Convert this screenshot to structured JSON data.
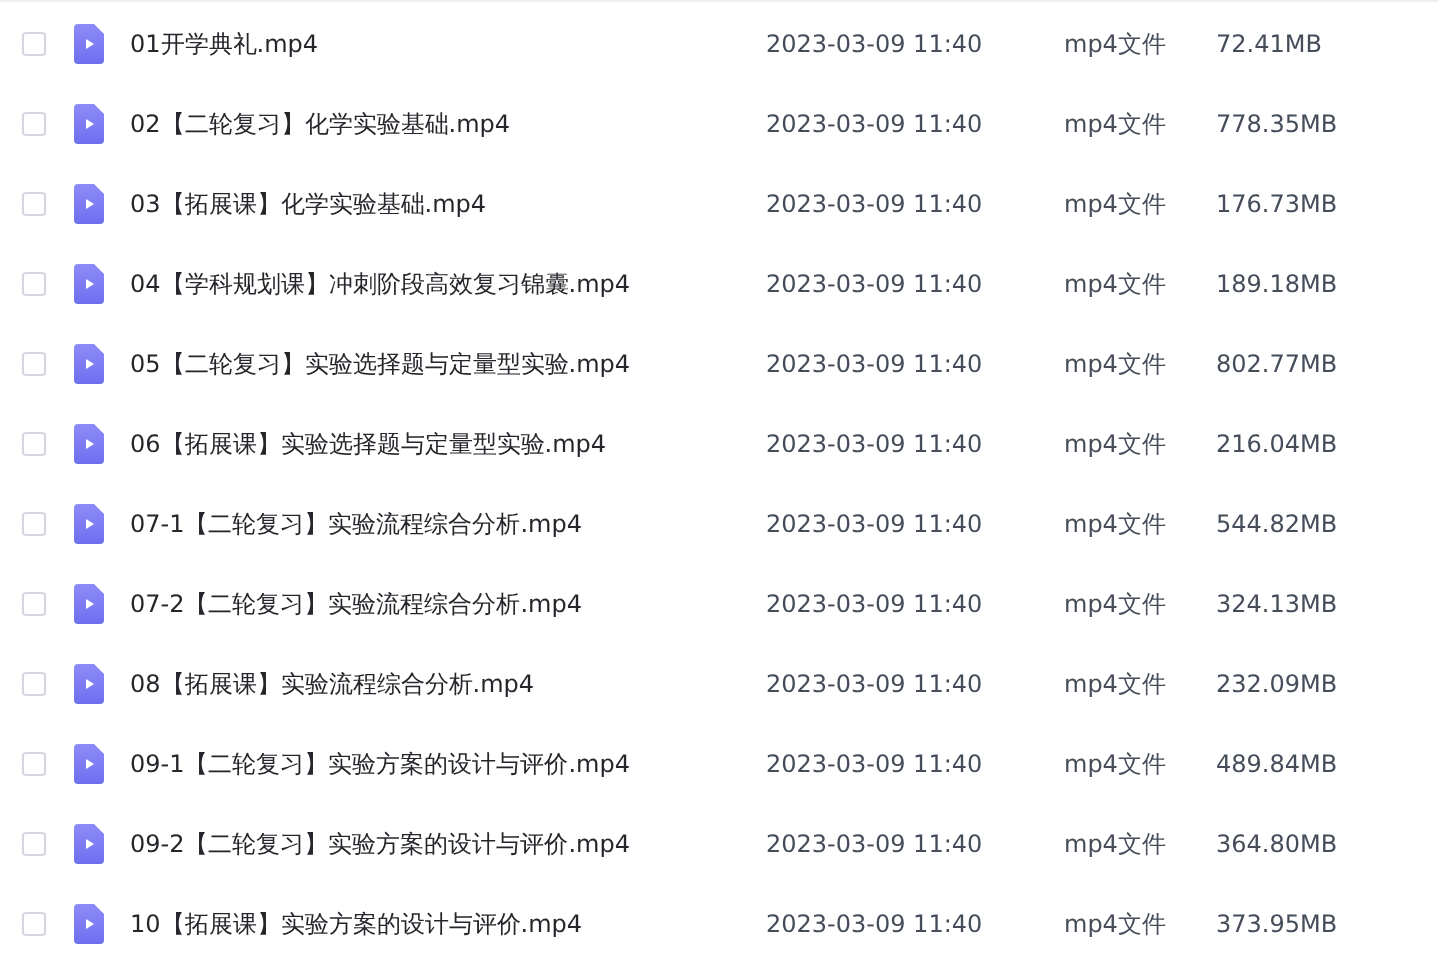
{
  "files": [
    {
      "name": "01开学典礼.mp4",
      "modified": "2023-03-09 11:40",
      "type": "mp4文件",
      "size": "72.41MB",
      "checked": false
    },
    {
      "name": "02【二轮复习】化学实验基础.mp4",
      "modified": "2023-03-09 11:40",
      "type": "mp4文件",
      "size": "778.35MB",
      "checked": false
    },
    {
      "name": "03【拓展课】化学实验基础.mp4",
      "modified": "2023-03-09 11:40",
      "type": "mp4文件",
      "size": "176.73MB",
      "checked": false
    },
    {
      "name": "04【学科规划课】冲刺阶段高效复习锦囊.mp4",
      "modified": "2023-03-09 11:40",
      "type": "mp4文件",
      "size": "189.18MB",
      "checked": false
    },
    {
      "name": "05【二轮复习】实验选择题与定量型实验.mp4",
      "modified": "2023-03-09 11:40",
      "type": "mp4文件",
      "size": "802.77MB",
      "checked": false
    },
    {
      "name": "06【拓展课】实验选择题与定量型实验.mp4",
      "modified": "2023-03-09 11:40",
      "type": "mp4文件",
      "size": "216.04MB",
      "checked": false
    },
    {
      "name": "07-1【二轮复习】实验流程综合分析.mp4",
      "modified": "2023-03-09 11:40",
      "type": "mp4文件",
      "size": "544.82MB",
      "checked": false
    },
    {
      "name": "07-2【二轮复习】实验流程综合分析.mp4",
      "modified": "2023-03-09 11:40",
      "type": "mp4文件",
      "size": "324.13MB",
      "checked": false
    },
    {
      "name": "08【拓展课】实验流程综合分析.mp4",
      "modified": "2023-03-09 11:40",
      "type": "mp4文件",
      "size": "232.09MB",
      "checked": false
    },
    {
      "name": "09-1【二轮复习】实验方案的设计与评价.mp4",
      "modified": "2023-03-09 11:40",
      "type": "mp4文件",
      "size": "489.84MB",
      "checked": false
    },
    {
      "name": "09-2【二轮复习】实验方案的设计与评价.mp4",
      "modified": "2023-03-09 11:40",
      "type": "mp4文件",
      "size": "364.80MB",
      "checked": false
    },
    {
      "name": "10【拓展课】实验方案的设计与评价.mp4",
      "modified": "2023-03-09 11:40",
      "type": "mp4文件",
      "size": "373.95MB",
      "checked": false
    }
  ]
}
